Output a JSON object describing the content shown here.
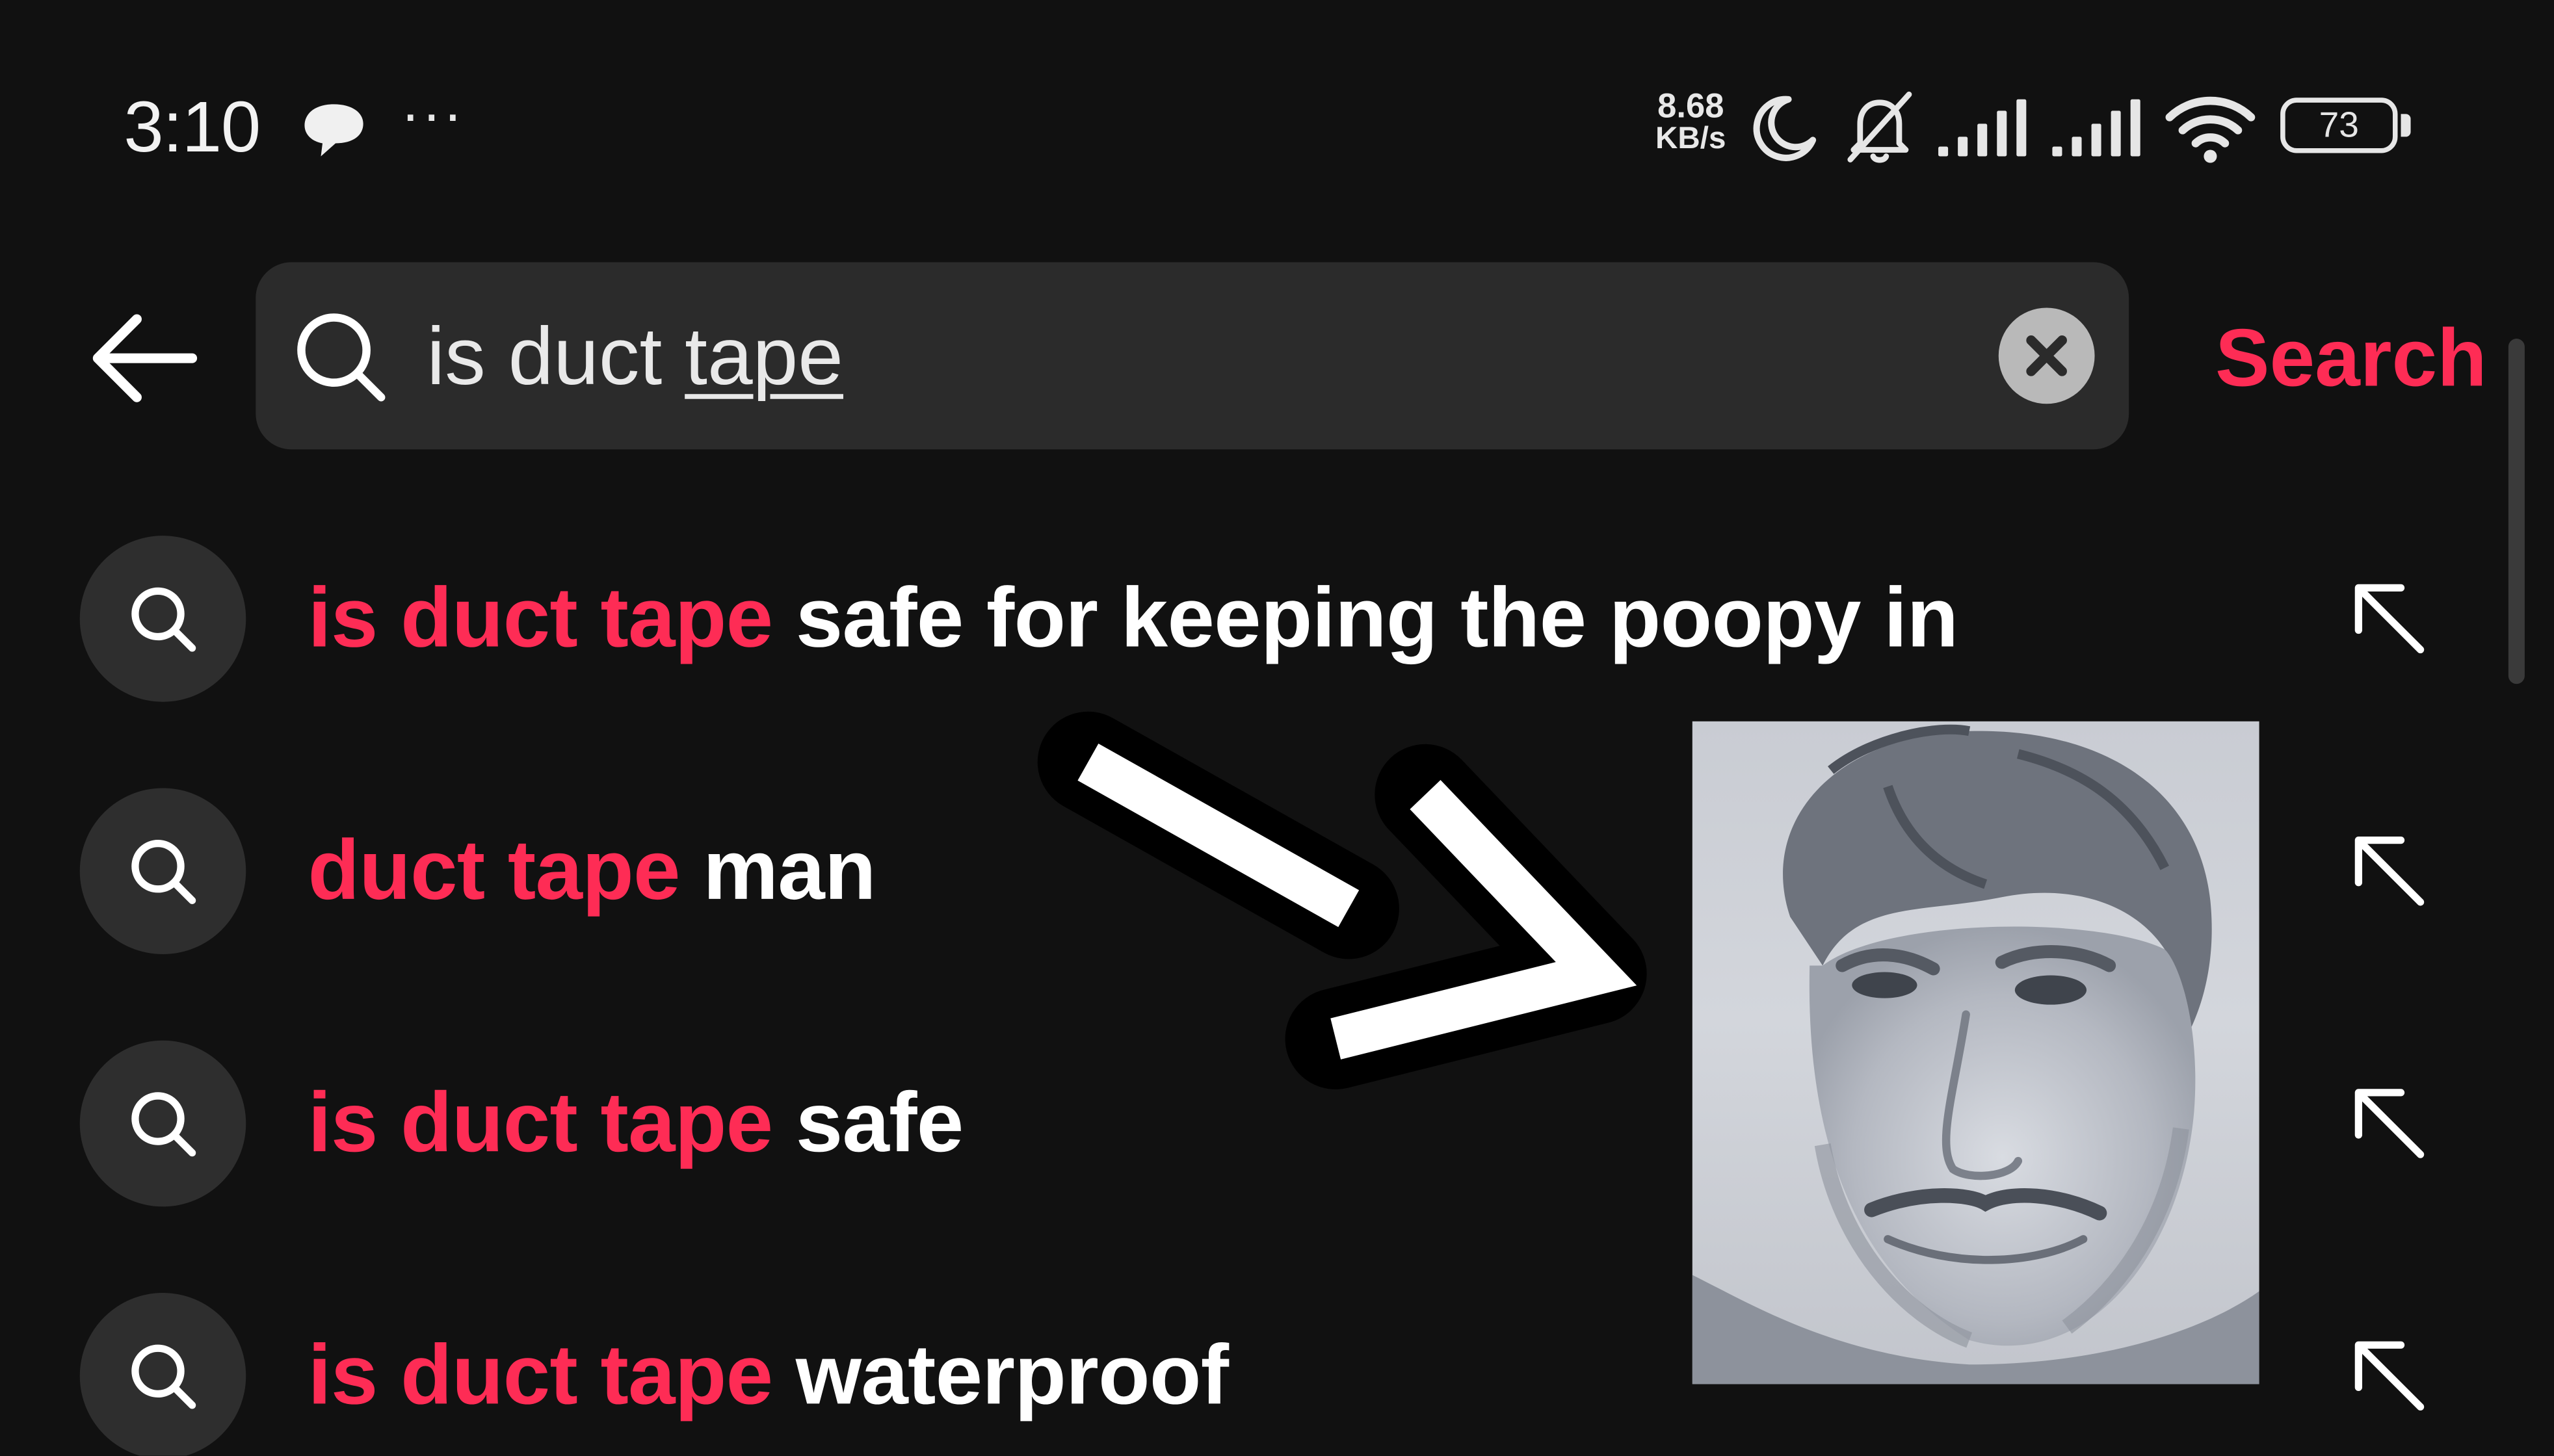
{
  "status_bar": {
    "time": "3:10",
    "message_icon": "chat-bubble-icon",
    "more": "···",
    "net_speed_value": "8.68",
    "net_speed_unit": "KB/s",
    "dnd_icon": "moon-icon",
    "mute_icon": "bell-off-icon",
    "signal_icons": [
      "signal-icon",
      "signal-icon"
    ],
    "wifi_icon": "wifi-icon",
    "battery_level": "73"
  },
  "search_bar": {
    "back_icon": "arrow-left-icon",
    "search_icon": "search-icon",
    "query_plain": "is duct ",
    "query_underlined": "tape",
    "clear_icon": "close-icon",
    "submit_label": "Search",
    "accent_color": "#fe2c55"
  },
  "suggestions": [
    {
      "highlight": "is duct tape",
      "rest": " safe for keeping the poopy in",
      "icon": "search-icon",
      "fill_icon": "arrow-up-left-icon"
    },
    {
      "highlight": "duct tape",
      "rest": " man",
      "icon": "search-icon",
      "fill_icon": "arrow-up-left-icon"
    },
    {
      "highlight": "is duct tape",
      "rest": " safe",
      "icon": "search-icon",
      "fill_icon": "arrow-up-left-icon"
    },
    {
      "highlight": "is duct tape",
      "rest": " waterproof",
      "icon": "search-icon",
      "fill_icon": "arrow-up-left-icon"
    }
  ],
  "overlay": {
    "arrow_icon": "arrow-down-right-icon",
    "image": "pencil-sketch-portrait"
  }
}
